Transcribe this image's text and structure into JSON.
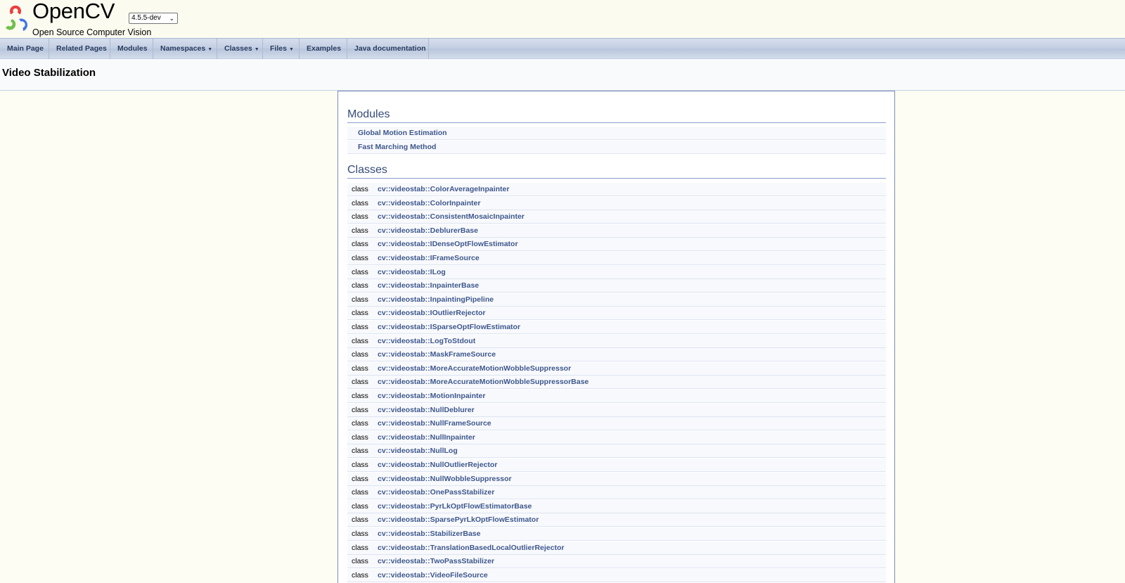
{
  "title_area": {
    "project_name": "OpenCV",
    "version": "4.5.5-dev",
    "brief": "Open Source Computer Vision"
  },
  "navbar": {
    "items": [
      {
        "label": "Main Page",
        "dropdown": false
      },
      {
        "label": "Related Pages",
        "dropdown": false
      },
      {
        "label": "Modules",
        "dropdown": false
      },
      {
        "label": "Namespaces",
        "dropdown": true
      },
      {
        "label": "Classes",
        "dropdown": true
      },
      {
        "label": "Files",
        "dropdown": true
      },
      {
        "label": "Examples",
        "dropdown": false
      },
      {
        "label": "Java documentation",
        "dropdown": false
      }
    ]
  },
  "page": {
    "title": "Video Stabilization"
  },
  "modules": {
    "heading": "Modules",
    "items": [
      "Global Motion Estimation",
      "Fast Marching Method"
    ]
  },
  "classes": {
    "heading": "Classes",
    "kind_label": "class",
    "items": [
      "cv::videostab::ColorAverageInpainter",
      "cv::videostab::ColorInpainter",
      "cv::videostab::ConsistentMosaicInpainter",
      "cv::videostab::DeblurerBase",
      "cv::videostab::IDenseOptFlowEstimator",
      "cv::videostab::IFrameSource",
      "cv::videostab::ILog",
      "cv::videostab::InpainterBase",
      "cv::videostab::InpaintingPipeline",
      "cv::videostab::IOutlierRejector",
      "cv::videostab::ISparseOptFlowEstimator",
      "cv::videostab::LogToStdout",
      "cv::videostab::MaskFrameSource",
      "cv::videostab::MoreAccurateMotionWobbleSuppressor",
      "cv::videostab::MoreAccurateMotionWobbleSuppressorBase",
      "cv::videostab::MotionInpainter",
      "cv::videostab::NullDeblurer",
      "cv::videostab::NullFrameSource",
      "cv::videostab::NullInpainter",
      "cv::videostab::NullLog",
      "cv::videostab::NullOutlierRejector",
      "cv::videostab::NullWobbleSuppressor",
      "cv::videostab::OnePassStabilizer",
      "cv::videostab::PyrLkOptFlowEstimatorBase",
      "cv::videostab::SparsePyrLkOptFlowEstimator",
      "cv::videostab::StabilizerBase",
      "cv::videostab::TranslationBasedLocalOutlierRejector",
      "cv::videostab::TwoPassStabilizer",
      "cv::videostab::VideoFileSource"
    ]
  },
  "colors": {
    "link": "#3d578c",
    "heading": "#354c7b",
    "logo_red": "#ef3b3b",
    "logo_green": "#6fc04d",
    "logo_blue": "#3e74e8"
  }
}
